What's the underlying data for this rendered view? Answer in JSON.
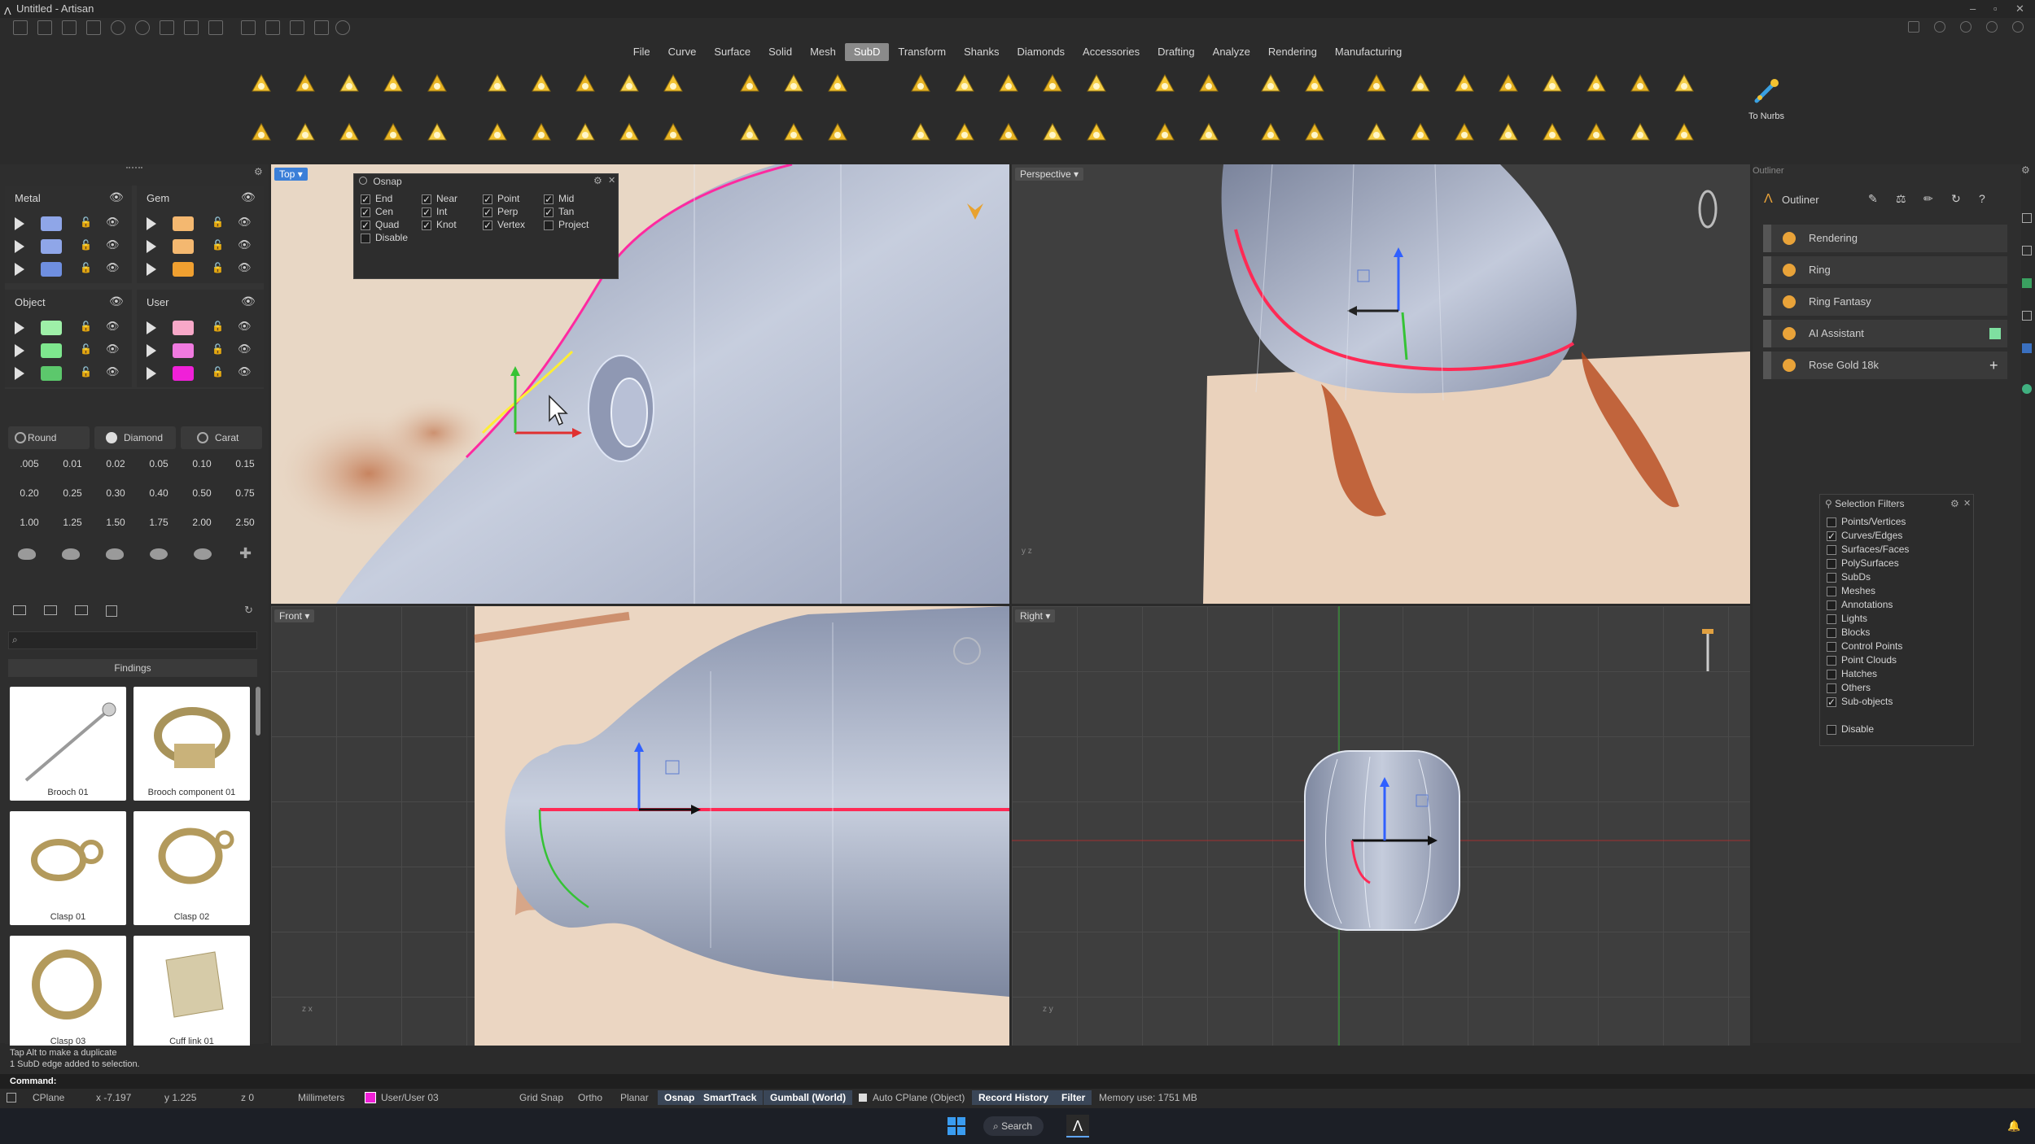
{
  "window": {
    "title": "Untitled - Artisan"
  },
  "menu": [
    {
      "label": "File",
      "active": false
    },
    {
      "label": "Curve",
      "active": false
    },
    {
      "label": "Surface",
      "active": false
    },
    {
      "label": "Solid",
      "active": false
    },
    {
      "label": "Mesh",
      "active": false
    },
    {
      "label": "SubD",
      "active": true
    },
    {
      "label": "Transform",
      "active": false
    },
    {
      "label": "Shanks",
      "active": false
    },
    {
      "label": "Diamonds",
      "active": false
    },
    {
      "label": "Accessories",
      "active": false
    },
    {
      "label": "Drafting",
      "active": false
    },
    {
      "label": "Analyze",
      "active": false
    },
    {
      "label": "Rendering",
      "active": false
    },
    {
      "label": "Manufacturing",
      "active": false
    }
  ],
  "ribbon": {
    "to_nurbs_label": "To Nurbs"
  },
  "layers": {
    "metal": {
      "title": "Metal",
      "colors": [
        "#8fa6e8",
        "#8fa6e8",
        "#6f8fe0"
      ]
    },
    "gem": {
      "title": "Gem",
      "colors": [
        "#f4b870",
        "#f4b870",
        "#f0a030"
      ]
    },
    "object": {
      "title": "Object",
      "colors": [
        "#9ef0a8",
        "#7ee78e",
        "#5cc86c"
      ]
    },
    "user": {
      "title": "User",
      "colors": [
        "#f7a8c8",
        "#f07ae0",
        "#f020d8"
      ]
    }
  },
  "gem_tools": {
    "shape_buttons": [
      "Round",
      "Diamond",
      "Carat"
    ],
    "sizes": [
      ".005",
      "0.01",
      "0.02",
      "0.05",
      "0.10",
      "0.15",
      "0.20",
      "0.25",
      "0.30",
      "0.40",
      "0.50",
      "0.75",
      "1.00",
      "1.25",
      "1.50",
      "1.75",
      "2.00",
      "2.50"
    ]
  },
  "findings": {
    "title": "Findings",
    "search_placeholder": "",
    "items": [
      "Brooch 01",
      "Brooch component 01",
      "Clasp 01",
      "Clasp 02",
      "Clasp 03",
      "Cuff link 01"
    ]
  },
  "viewports": {
    "top": "Top",
    "perspective": "Perspective",
    "front": "Front",
    "right": "Right"
  },
  "osnap": {
    "title": "Osnap",
    "items": [
      {
        "label": "End",
        "on": true
      },
      {
        "label": "Near",
        "on": true
      },
      {
        "label": "Point",
        "on": true
      },
      {
        "label": "Mid",
        "on": true
      },
      {
        "label": "Cen",
        "on": true
      },
      {
        "label": "Int",
        "on": true
      },
      {
        "label": "Perp",
        "on": true
      },
      {
        "label": "Tan",
        "on": true
      },
      {
        "label": "Quad",
        "on": true
      },
      {
        "label": "Knot",
        "on": true
      },
      {
        "label": "Vertex",
        "on": true
      },
      {
        "label": "Project",
        "on": false
      },
      {
        "label": "Disable",
        "on": false
      }
    ]
  },
  "outliner": {
    "title": "Outliner",
    "panel_label": "Outliner",
    "items": [
      "Rendering",
      "Ring",
      "Ring Fantasy",
      "AI Assistant",
      "Rose Gold 18k"
    ]
  },
  "selection_filters": {
    "title": "Selection Filters",
    "items": [
      {
        "label": "Points/Vertices",
        "on": false
      },
      {
        "label": "Curves/Edges",
        "on": true
      },
      {
        "label": "Surfaces/Faces",
        "on": false
      },
      {
        "label": "PolySurfaces",
        "on": false
      },
      {
        "label": "SubDs",
        "on": false
      },
      {
        "label": "Meshes",
        "on": false
      },
      {
        "label": "Annotations",
        "on": false
      },
      {
        "label": "Lights",
        "on": false
      },
      {
        "label": "Blocks",
        "on": false
      },
      {
        "label": "Control Points",
        "on": false
      },
      {
        "label": "Point Clouds",
        "on": false
      },
      {
        "label": "Hatches",
        "on": false
      },
      {
        "label": "Others",
        "on": false
      },
      {
        "label": "Sub-objects",
        "on": true
      }
    ],
    "disable_label": "Disable"
  },
  "command": {
    "history": [
      "Tap Alt to make a duplicate",
      "1 SubD edge added to selection."
    ],
    "prompt": "Command:"
  },
  "status": {
    "cplane": "CPlane",
    "x": "x -7.197",
    "y": "y 1.225",
    "z": "z 0",
    "units": "Millimeters",
    "layer": "User/User 03",
    "layer_color": "#f020d8",
    "grid_snap": "Grid Snap",
    "ortho": "Ortho",
    "planar": "Planar",
    "osnap": "Osnap",
    "smarttrack": "SmartTrack",
    "gumball": "Gumball (World)",
    "auto_cplane": "Auto CPlane (Object)",
    "record_history": "Record History",
    "filter": "Filter",
    "memory": "Memory use: 1751 MB"
  },
  "taskbar": {
    "search": "Search"
  }
}
